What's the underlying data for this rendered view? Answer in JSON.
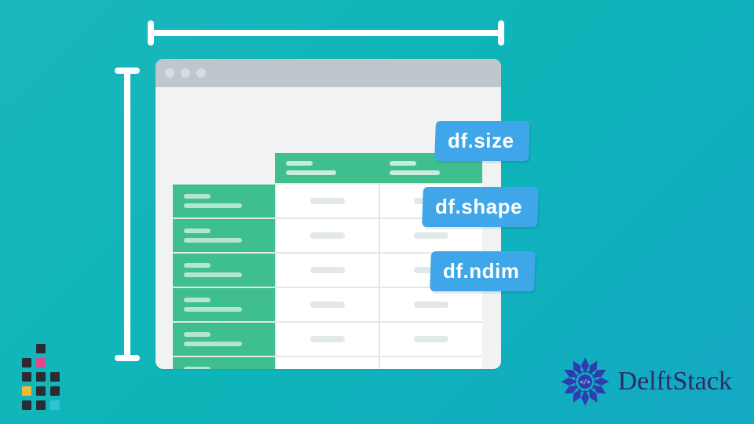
{
  "labels": {
    "size": "df.size",
    "shape": "df.shape",
    "ndim": "df.ndim"
  },
  "brand": {
    "name": "DelftStack"
  },
  "illustration": {
    "window_dots": 3,
    "table": {
      "rows": 6,
      "cols": 3
    },
    "rulers": [
      "top",
      "left"
    ]
  },
  "colors": {
    "bg_from": "#1bb7bd",
    "bg_to": "#15a8c5",
    "tag": "#3fa7e9",
    "green": "#3fbf8e",
    "brand": "#2d2d66"
  }
}
